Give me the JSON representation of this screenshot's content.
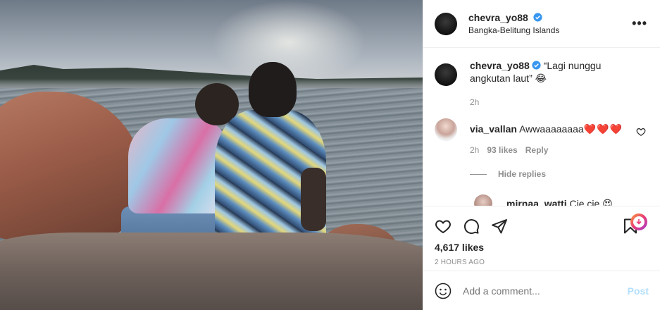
{
  "post": {
    "author": "chevra_yo88",
    "location": "Bangka-Belitung Islands",
    "more_label": "•••"
  },
  "caption": {
    "author": "chevra_yo88",
    "text": "“Lagi nunggu angkutan laut” 😂",
    "time": "2h"
  },
  "comments": [
    {
      "author": "via_vallan",
      "text": "Awwaaaaaaaa",
      "hearts": "❤️❤️❤️",
      "time": "2h",
      "likes": "93 likes",
      "reply_label": "Reply"
    }
  ],
  "hide_replies": "Hide replies",
  "reply": {
    "author": "mirnaa_watti",
    "text": "Cie cie 😍"
  },
  "likes": "4,617 likes",
  "posted_ago": "2 HOURS AGO",
  "add_comment": {
    "placeholder": "Add a comment...",
    "post_label": "Post"
  },
  "colors": {
    "verified": "#3897f0",
    "post_button": "#b2dffc",
    "secondary_text": "#8e8e8e"
  },
  "icons": [
    "verified-icon",
    "more-icon",
    "heart-icon",
    "comment-icon",
    "share-icon",
    "bookmark-icon",
    "download-icon",
    "emoji-icon",
    "comment-heart-icon"
  ]
}
